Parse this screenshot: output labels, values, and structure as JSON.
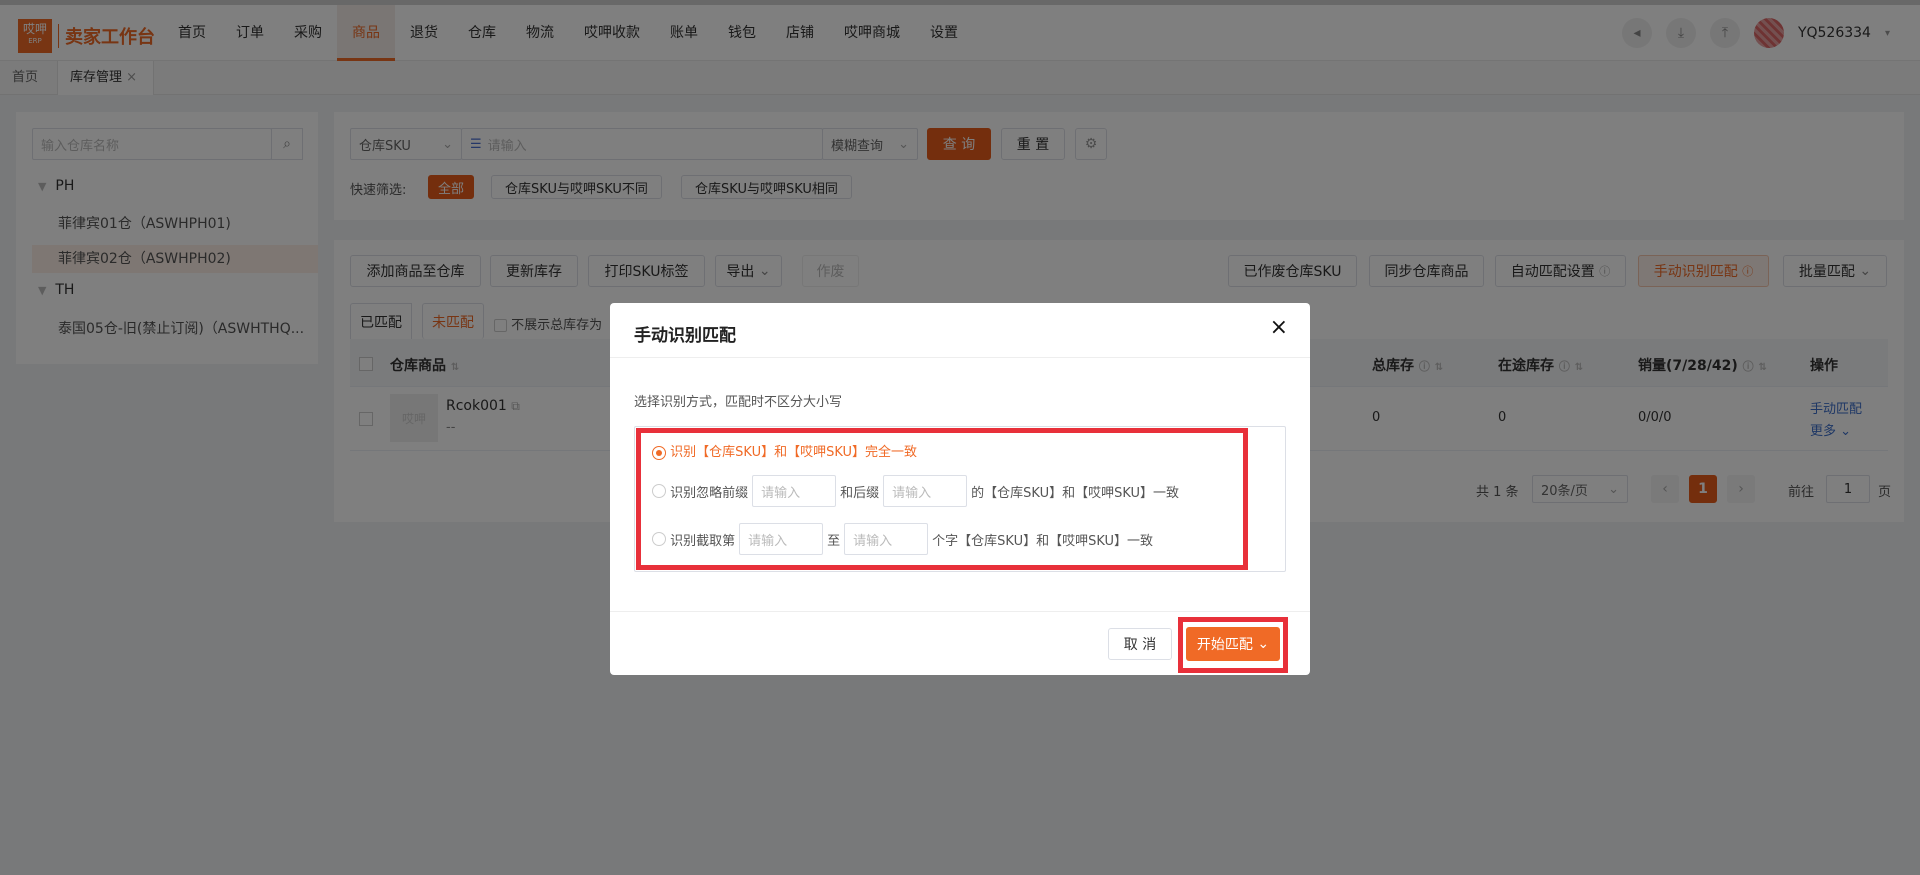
{
  "app": {
    "logo_text": "哎呷",
    "logo_sub": "ERP",
    "title": "卖家工作台",
    "user": "YQ526334"
  },
  "nav": [
    "首页",
    "订单",
    "采购",
    "商品",
    "退货",
    "仓库",
    "物流",
    "哎呷收款",
    "账单",
    "钱包",
    "店铺",
    "哎呷商城",
    "设置"
  ],
  "tabs": {
    "home": "首页",
    "current": "库存管理",
    "close": "×"
  },
  "sidebar": {
    "search_placeholder": "输入仓库名称",
    "groups": [
      {
        "name": "PH",
        "items": [
          "菲律宾01仓（ASWHPH01)",
          "菲律宾02仓（ASWHPH02)"
        ]
      },
      {
        "name": "TH",
        "items": [
          "泰国05仓-旧(禁止订阅)（ASWHTHQ..."
        ]
      }
    ]
  },
  "filter": {
    "field_select": "仓库SKU",
    "input_placeholder": "请输入",
    "mode_select": "模糊查询",
    "query_btn": "查 询",
    "reset_btn": "重 置",
    "quick_label": "快速筛选:",
    "quick_options": [
      "全部",
      "仓库SKU与哎呷SKU不同",
      "仓库SKU与哎呷SKU相同"
    ]
  },
  "toolbar": {
    "left": [
      "添加商品至仓库",
      "更新库存",
      "打印SKU标签",
      "导出",
      "作废"
    ],
    "right": [
      "已作废仓库SKU",
      "同步仓库商品",
      "自动匹配设置",
      "手动识别匹配",
      "批量匹配"
    ]
  },
  "subtabs": [
    "已匹配",
    "未匹配"
  ],
  "hide_label": "不展示总库存为",
  "table": {
    "headers": {
      "product": "仓库商品",
      "total": "总库存",
      "transit": "在途库存",
      "sales": "销量(7/28/42)",
      "ops": "操作"
    },
    "row": {
      "thumb": "哎呷",
      "sku": "Rcok001",
      "sub": "--",
      "total": "0",
      "transit": "0",
      "sales": "0/0/0",
      "op1": "手动匹配",
      "op2": "更多"
    }
  },
  "pagination": {
    "total": "共 1 条",
    "page_size": "20条/页",
    "page": "1",
    "goto_label": "前往",
    "goto_value": "1",
    "page_unit": "页"
  },
  "modal": {
    "title": "手动识别匹配",
    "close": "×",
    "hint": "选择识别方式，匹配时不区分大小写",
    "option1": "识别【仓库SKU】和【哎呷SKU】完全一致",
    "option2_a": "识别忽略前缀",
    "option2_b": "和后缀",
    "option2_c": "的【仓库SKU】和【哎呷SKU】一致",
    "option3_a": "识别截取第",
    "option3_b": "至",
    "option3_c": "个字【仓库SKU】和【哎呷SKU】一致",
    "placeholder": "请输入",
    "cancel": "取 消",
    "start": "开始匹配"
  },
  "colors": {
    "accent": "#f06a26",
    "highlight": "#e8303a"
  }
}
